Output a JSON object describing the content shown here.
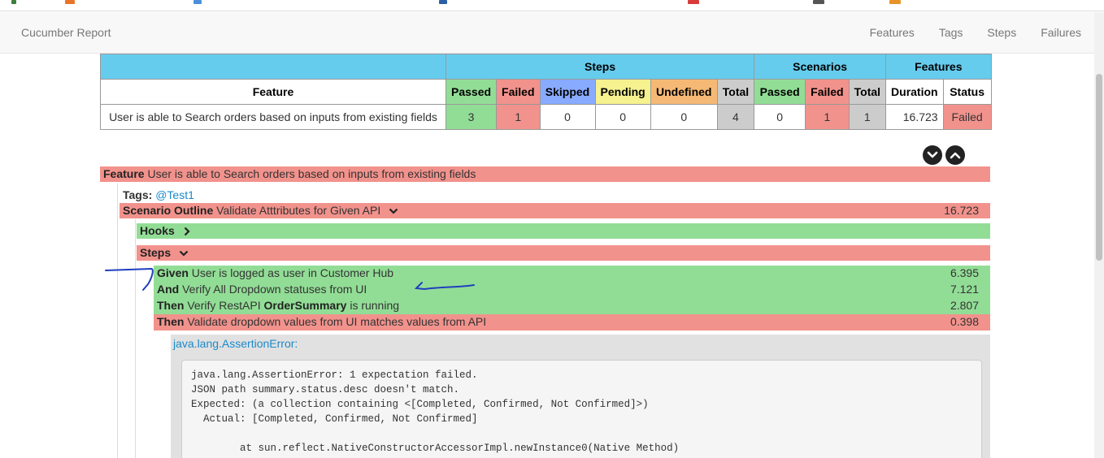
{
  "navbar": {
    "brand": "Cucumber Report",
    "links": [
      "Features",
      "Tags",
      "Steps",
      "Failures"
    ]
  },
  "stats": {
    "group_headers": {
      "steps": "Steps",
      "scenarios": "Scenarios",
      "features": "Features"
    },
    "columns": [
      "Feature",
      "Passed",
      "Failed",
      "Skipped",
      "Pending",
      "Undefined",
      "Total",
      "Passed",
      "Failed",
      "Total",
      "Duration",
      "Status"
    ],
    "row": {
      "feature": "User is able to Search orders based on inputs from existing fields",
      "steps_passed": "3",
      "steps_failed": "1",
      "steps_skipped": "0",
      "steps_pending": "0",
      "steps_undefined": "0",
      "steps_total": "4",
      "scenarios_passed": "0",
      "scenarios_failed": "1",
      "scenarios_total": "1",
      "duration": "16.723",
      "status": "Failed"
    }
  },
  "report": {
    "feature_keyword": "Feature",
    "feature_name": "User is able to Search orders based on inputs from existing fields",
    "tags_label": "Tags:",
    "tag": "@Test1",
    "scenario_keyword": "Scenario Outline",
    "scenario_name": "Validate Atttributes for Given API",
    "scenario_duration": "16.723",
    "hooks_label": "Hooks",
    "steps_label": "Steps",
    "steps": [
      {
        "keyword": "Given",
        "text": "User is logged as user in Customer Hub",
        "duration": "6.395",
        "status": "passed"
      },
      {
        "keyword": "And",
        "text": "Verify All Dropdown statuses from UI",
        "duration": "7.121",
        "status": "passed"
      },
      {
        "keyword": "Then",
        "text_before": "Verify RestAPI ",
        "text_bold": "OrderSummary",
        "text_after": " is running",
        "duration": "2.807",
        "status": "passed"
      },
      {
        "keyword": "Then",
        "text": "Validate dropdown values from UI matches values from API",
        "duration": "0.398",
        "status": "failed"
      }
    ],
    "error": {
      "title": "java.lang.AssertionError:",
      "lines": [
        "java.lang.AssertionError: 1 expectation failed.",
        "JSON path summary.status.desc doesn't match.",
        "Expected: (a collection containing <[Completed, Confirmed, Not Confirmed]>)",
        "  Actual: [Completed, Confirmed, Not Confirmed]",
        "",
        "        at sun.reflect.NativeConstructorAccessorImpl.newInstance0(Native Method)"
      ]
    }
  },
  "colors": {
    "passed": "#92dd96",
    "failed": "#f2928c",
    "skipped": "#88aaff",
    "pending": "#f5f28f",
    "undefined": "#f5b975",
    "total": "#cccccc",
    "header": "#66ccee",
    "annotation": "#1f3fbf"
  },
  "icons": [
    "chevron-down-circle-icon",
    "chevron-up-circle-icon",
    "chevron-down-icon",
    "chevron-right-icon"
  ]
}
